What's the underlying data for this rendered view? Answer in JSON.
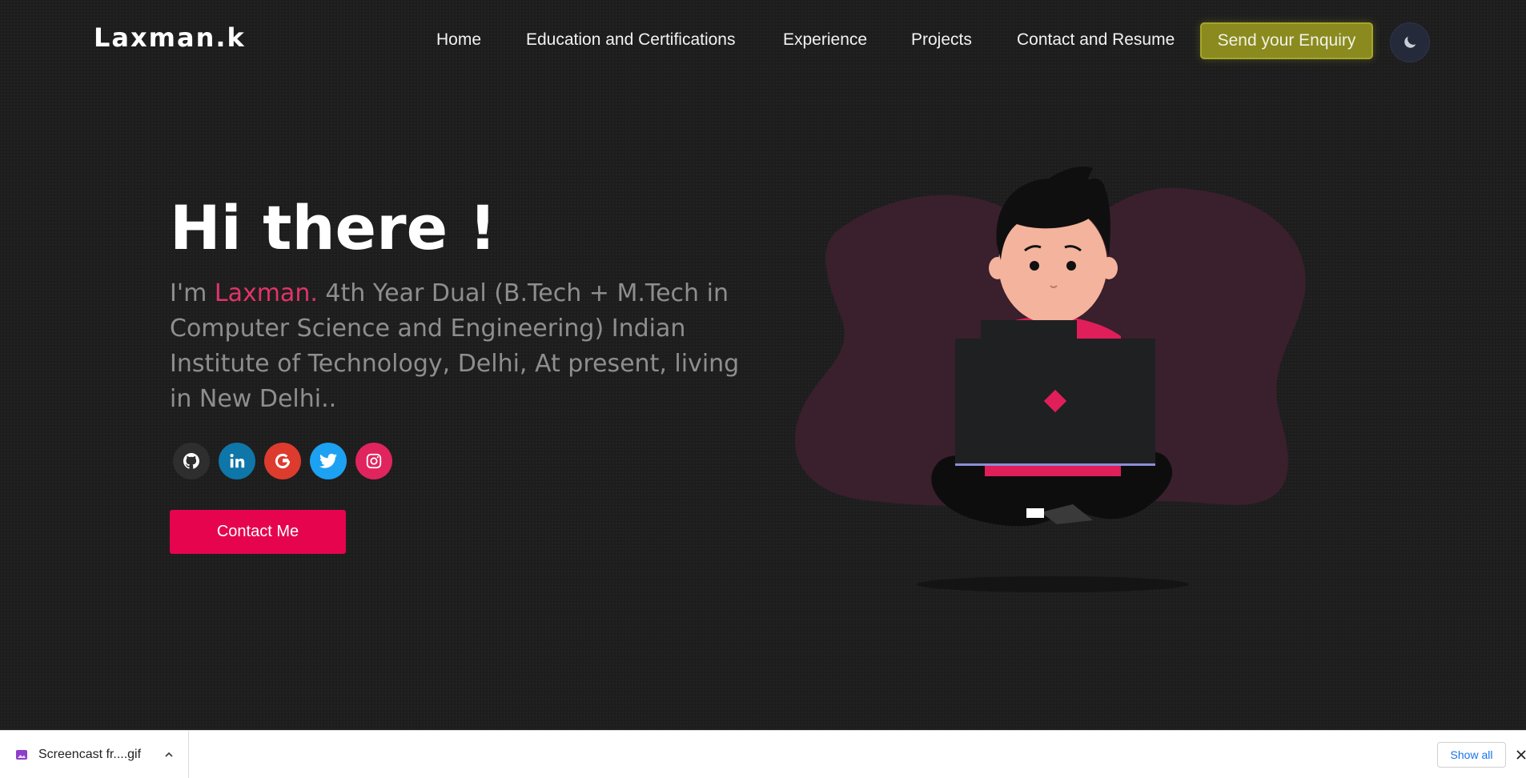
{
  "header": {
    "logo": "Laxman.k",
    "nav": {
      "home": "Home",
      "education": "Education and Certifications",
      "experience": "Experience",
      "projects": "Projects",
      "contact": "Contact and Resume"
    },
    "enquiry_label": "Send your Enquiry",
    "theme_toggle_icon": "moon-icon"
  },
  "hero": {
    "title": "Hi there !",
    "intro_prefix": "I'm ",
    "name": "Laxman.",
    "description": " 4th Year Dual (B.Tech + M.Tech in Computer Science and Engineering) Indian Institute of Technology, Delhi, At present, living in New Delhi..",
    "socials": [
      "github-icon",
      "linkedin-icon",
      "google-icon",
      "twitter-icon",
      "instagram-icon"
    ],
    "contact_label": "Contact Me"
  },
  "download_bar": {
    "file_name": "Screencast fr....gif",
    "show_all_label": "Show all"
  },
  "colors": {
    "accent": "#e2336b",
    "contact_button": "#e6044e",
    "enquiry_button": "#8a8a1f",
    "background": "#1d1d1d",
    "blob": "#3a1f2c"
  }
}
